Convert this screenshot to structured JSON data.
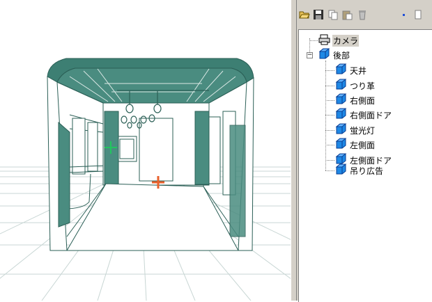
{
  "tree": {
    "camera": {
      "label": "カメラ",
      "icon": "printer-camera-icon"
    },
    "root": {
      "label": "後部",
      "expander": "−",
      "icon": "blue-cube-icon",
      "children": [
        {
          "label": "天井"
        },
        {
          "label": "つり革"
        },
        {
          "label": "右側面"
        },
        {
          "label": "右側面ドア"
        },
        {
          "label": "蛍光灯"
        },
        {
          "label": "左側面"
        },
        {
          "label": "左側面ドア"
        },
        {
          "label": "吊り広告"
        }
      ]
    }
  },
  "toolbar": {
    "icons": [
      "open-folder-icon",
      "save-icon",
      "copy-icon",
      "paste-icon",
      "delete-icon",
      "small-dot-icon",
      "page-icon"
    ]
  },
  "colors": {
    "model_fill": "#3d7f73",
    "cube_blue": "#1e88e5",
    "grid": "#c8d6d4",
    "panel_bg": "#d4d0c8"
  }
}
